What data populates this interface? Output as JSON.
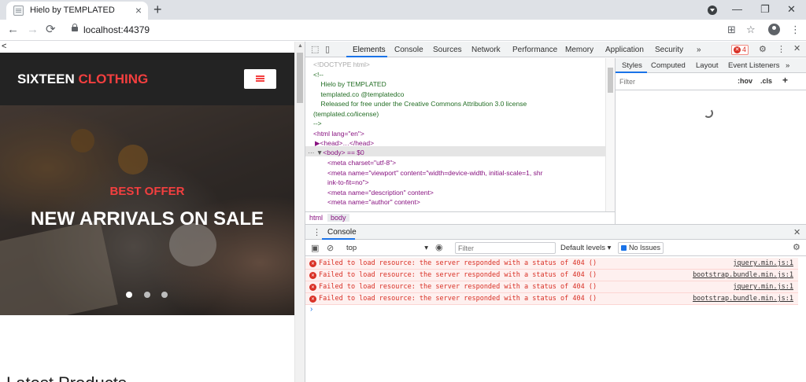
{
  "browser": {
    "tab_title": "Hielo by TEMPLATED",
    "tab_close": "×",
    "new_tab": "+",
    "window_controls": [
      "—",
      "❐",
      "✕"
    ],
    "url": "localhost:44379",
    "nav": {
      "back": "←",
      "forward": "→",
      "reload": "⟳"
    },
    "toolbar_icons": {
      "translate": "⊞",
      "star": "☆",
      "menu": "⋮"
    }
  },
  "page": {
    "back_link": "<",
    "brand_part1": "SIXTEEN",
    "brand_part2": "CLOTHING",
    "hero_eyebrow": "BEST OFFER",
    "hero_title": "NEW ARRIVALS ON SALE",
    "section_title": "Latest Products",
    "slider_dots": 3,
    "colors": {
      "accent": "#f33f3f",
      "header_bg": "#232323"
    }
  },
  "devtools": {
    "tabs": [
      "Elements",
      "Console",
      "Sources",
      "Network",
      "Performance",
      "Memory",
      "Application",
      "Security"
    ],
    "more_tabs": "»",
    "error_count": "4",
    "active_tab": "Elements",
    "elements_lines": [
      "<!DOCTYPE html>",
      "<!--",
      "    Hielo by TEMPLATED",
      "    templated.co @templatedco",
      "    Released for free under the Creative Commons Attribution 3.0 license",
      "(templated.co/license)",
      "-->",
      "<html lang=\"en\">",
      "▶<head>…</head>",
      "<body> == $0",
      "<meta charset=\"utf-8\">",
      "<meta name=\"viewport\" content=\"width=device-width, initial-scale=1, shr",
      "ink-to-fit=no\">",
      "<meta name=\"description\" content>",
      "<meta name=\"author\" content>"
    ],
    "breadcrumbs": [
      "html",
      "body"
    ],
    "styles_tabs": [
      "Styles",
      "Computed",
      "Layout",
      "Event Listeners"
    ],
    "styles_more": "»",
    "styles_filter_placeholder": "Filter",
    "styles_tools": [
      ":hov",
      ".cls",
      "+"
    ],
    "drawer_tab": "Console",
    "console": {
      "context": "top",
      "filter_placeholder": "Filter",
      "levels": "Default levels ▾",
      "issues": "No Issues",
      "messages": [
        {
          "text": "Failed to load resource: the server responded with a status of 404 ()",
          "source": "jquery.min.js:1"
        },
        {
          "text": "Failed to load resource: the server responded with a status of 404 ()",
          "source": "bootstrap.bundle.min.js:1"
        },
        {
          "text": "Failed to load resource: the server responded with a status of 404 ()",
          "source": "jquery.min.js:1"
        },
        {
          "text": "Failed to load resource: the server responded with a status of 404 ()",
          "source": "bootstrap.bundle.min.js:1"
        }
      ],
      "prompt": "›"
    }
  }
}
